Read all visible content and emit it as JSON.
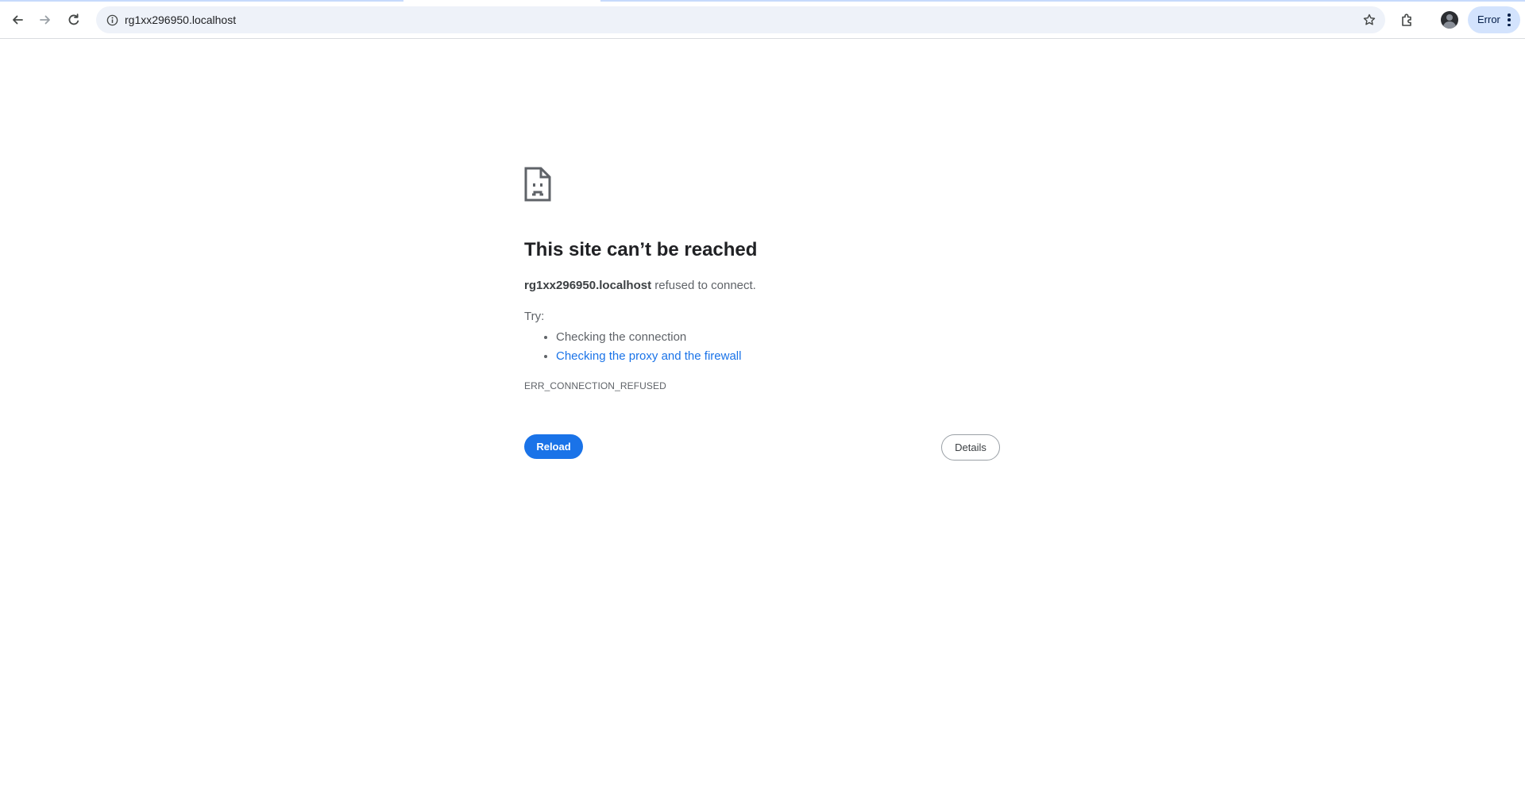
{
  "browser": {
    "url": "rg1xx296950.localhost",
    "error_chip_label": "Error",
    "icons": {
      "back": "arrow-left-icon",
      "forward": "arrow-right-icon",
      "reload": "reload-icon",
      "site_info": "info-icon",
      "bookmark": "star-icon",
      "extensions": "puzzle-icon",
      "profile": "avatar",
      "menu": "kebab-menu-icon"
    }
  },
  "error_page": {
    "icon": "sad-document-icon",
    "title": "This site can’t be reached",
    "host": "rg1xx296950.localhost",
    "summary_suffix": " refused to connect.",
    "try_label": "Try:",
    "suggestions": [
      {
        "text": "Checking the connection",
        "is_link": false
      },
      {
        "text": "Checking the proxy and the firewall",
        "is_link": true
      }
    ],
    "error_code": "ERR_CONNECTION_REFUSED",
    "reload_label": "Reload",
    "details_label": "Details"
  },
  "colors": {
    "accent": "#1a73e8",
    "omnibox_bg": "#eef2f9",
    "error_chip_bg": "#d3e3fd"
  }
}
